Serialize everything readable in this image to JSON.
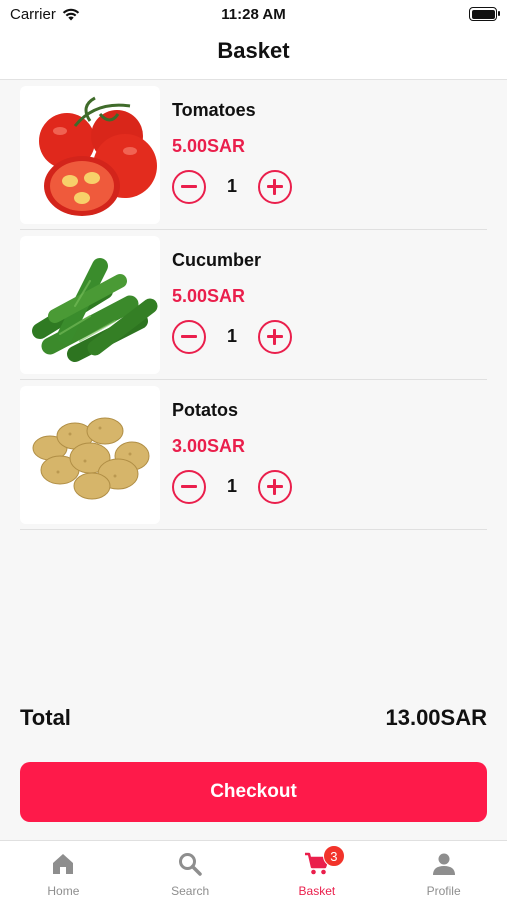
{
  "status_bar": {
    "carrier": "Carrier",
    "time": "11:28 AM"
  },
  "header": {
    "title": "Basket"
  },
  "items": [
    {
      "name": "Tomatoes",
      "price": "5.00SAR",
      "quantity": "1",
      "image_icon": "tomatoes-image"
    },
    {
      "name": "Cucumber",
      "price": "5.00SAR",
      "quantity": "1",
      "image_icon": "cucumber-image"
    },
    {
      "name": "Potatos",
      "price": "3.00SAR",
      "quantity": "1",
      "image_icon": "potatoes-image"
    }
  ],
  "summary": {
    "total_label": "Total",
    "total_value": "13.00SAR"
  },
  "checkout": {
    "label": "Checkout"
  },
  "tabs": [
    {
      "label": "Home",
      "icon": "home-icon",
      "active": false
    },
    {
      "label": "Search",
      "icon": "search-icon",
      "active": false
    },
    {
      "label": "Basket",
      "icon": "cart-icon",
      "active": true,
      "badge": "3"
    },
    {
      "label": "Profile",
      "icon": "profile-icon",
      "active": false
    }
  ],
  "colors": {
    "accent": "#ea1f4c",
    "button": "#fe1a4a",
    "badge": "#f2332a",
    "inactive": "#8e8e8e"
  }
}
